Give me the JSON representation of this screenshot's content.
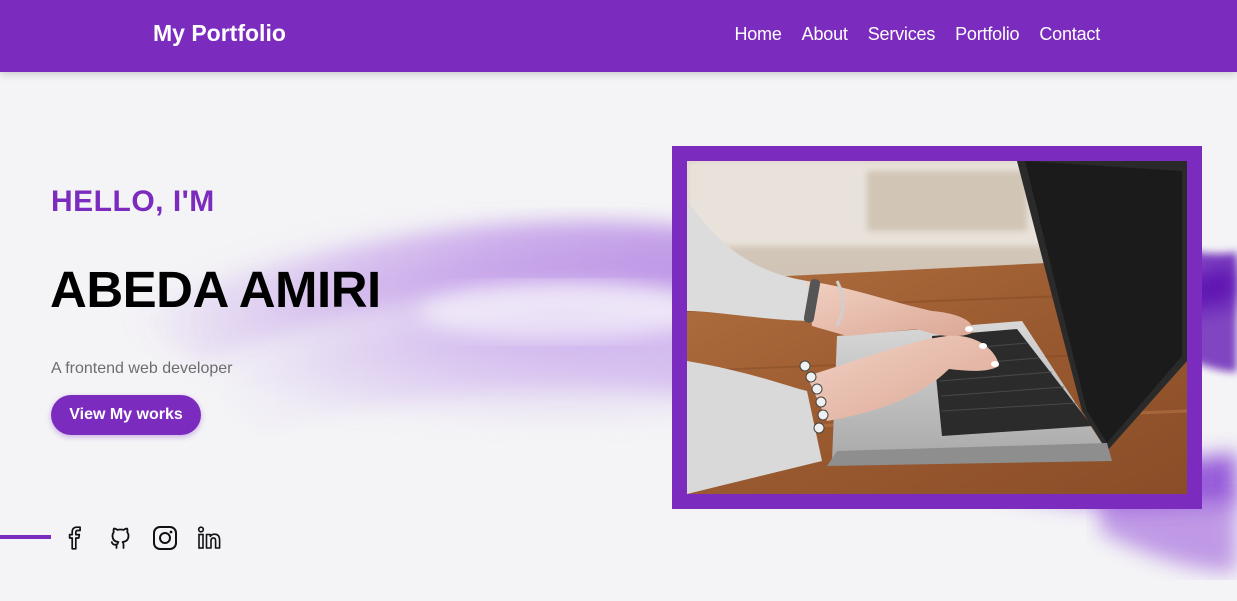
{
  "header": {
    "brand": "My Portfolio",
    "nav": [
      "Home",
      "About",
      "Services",
      "Portfolio",
      "Contact"
    ]
  },
  "hero": {
    "eyebrow": "HELLO, I'M",
    "name": "ABEDA AMIRI",
    "tagline": "A frontend web developer",
    "cta_label": "View My works"
  },
  "socials": [
    {
      "icon": "facebook-icon"
    },
    {
      "icon": "github-icon"
    },
    {
      "icon": "instagram-icon"
    },
    {
      "icon": "linkedin-icon"
    }
  ],
  "photo": {
    "subject": "hands-typing-on-laptop"
  },
  "colors": {
    "accent": "#7b2cbf",
    "background": "#f4f4f6",
    "heading": "#000000",
    "muted_text": "#6d6d6d"
  }
}
